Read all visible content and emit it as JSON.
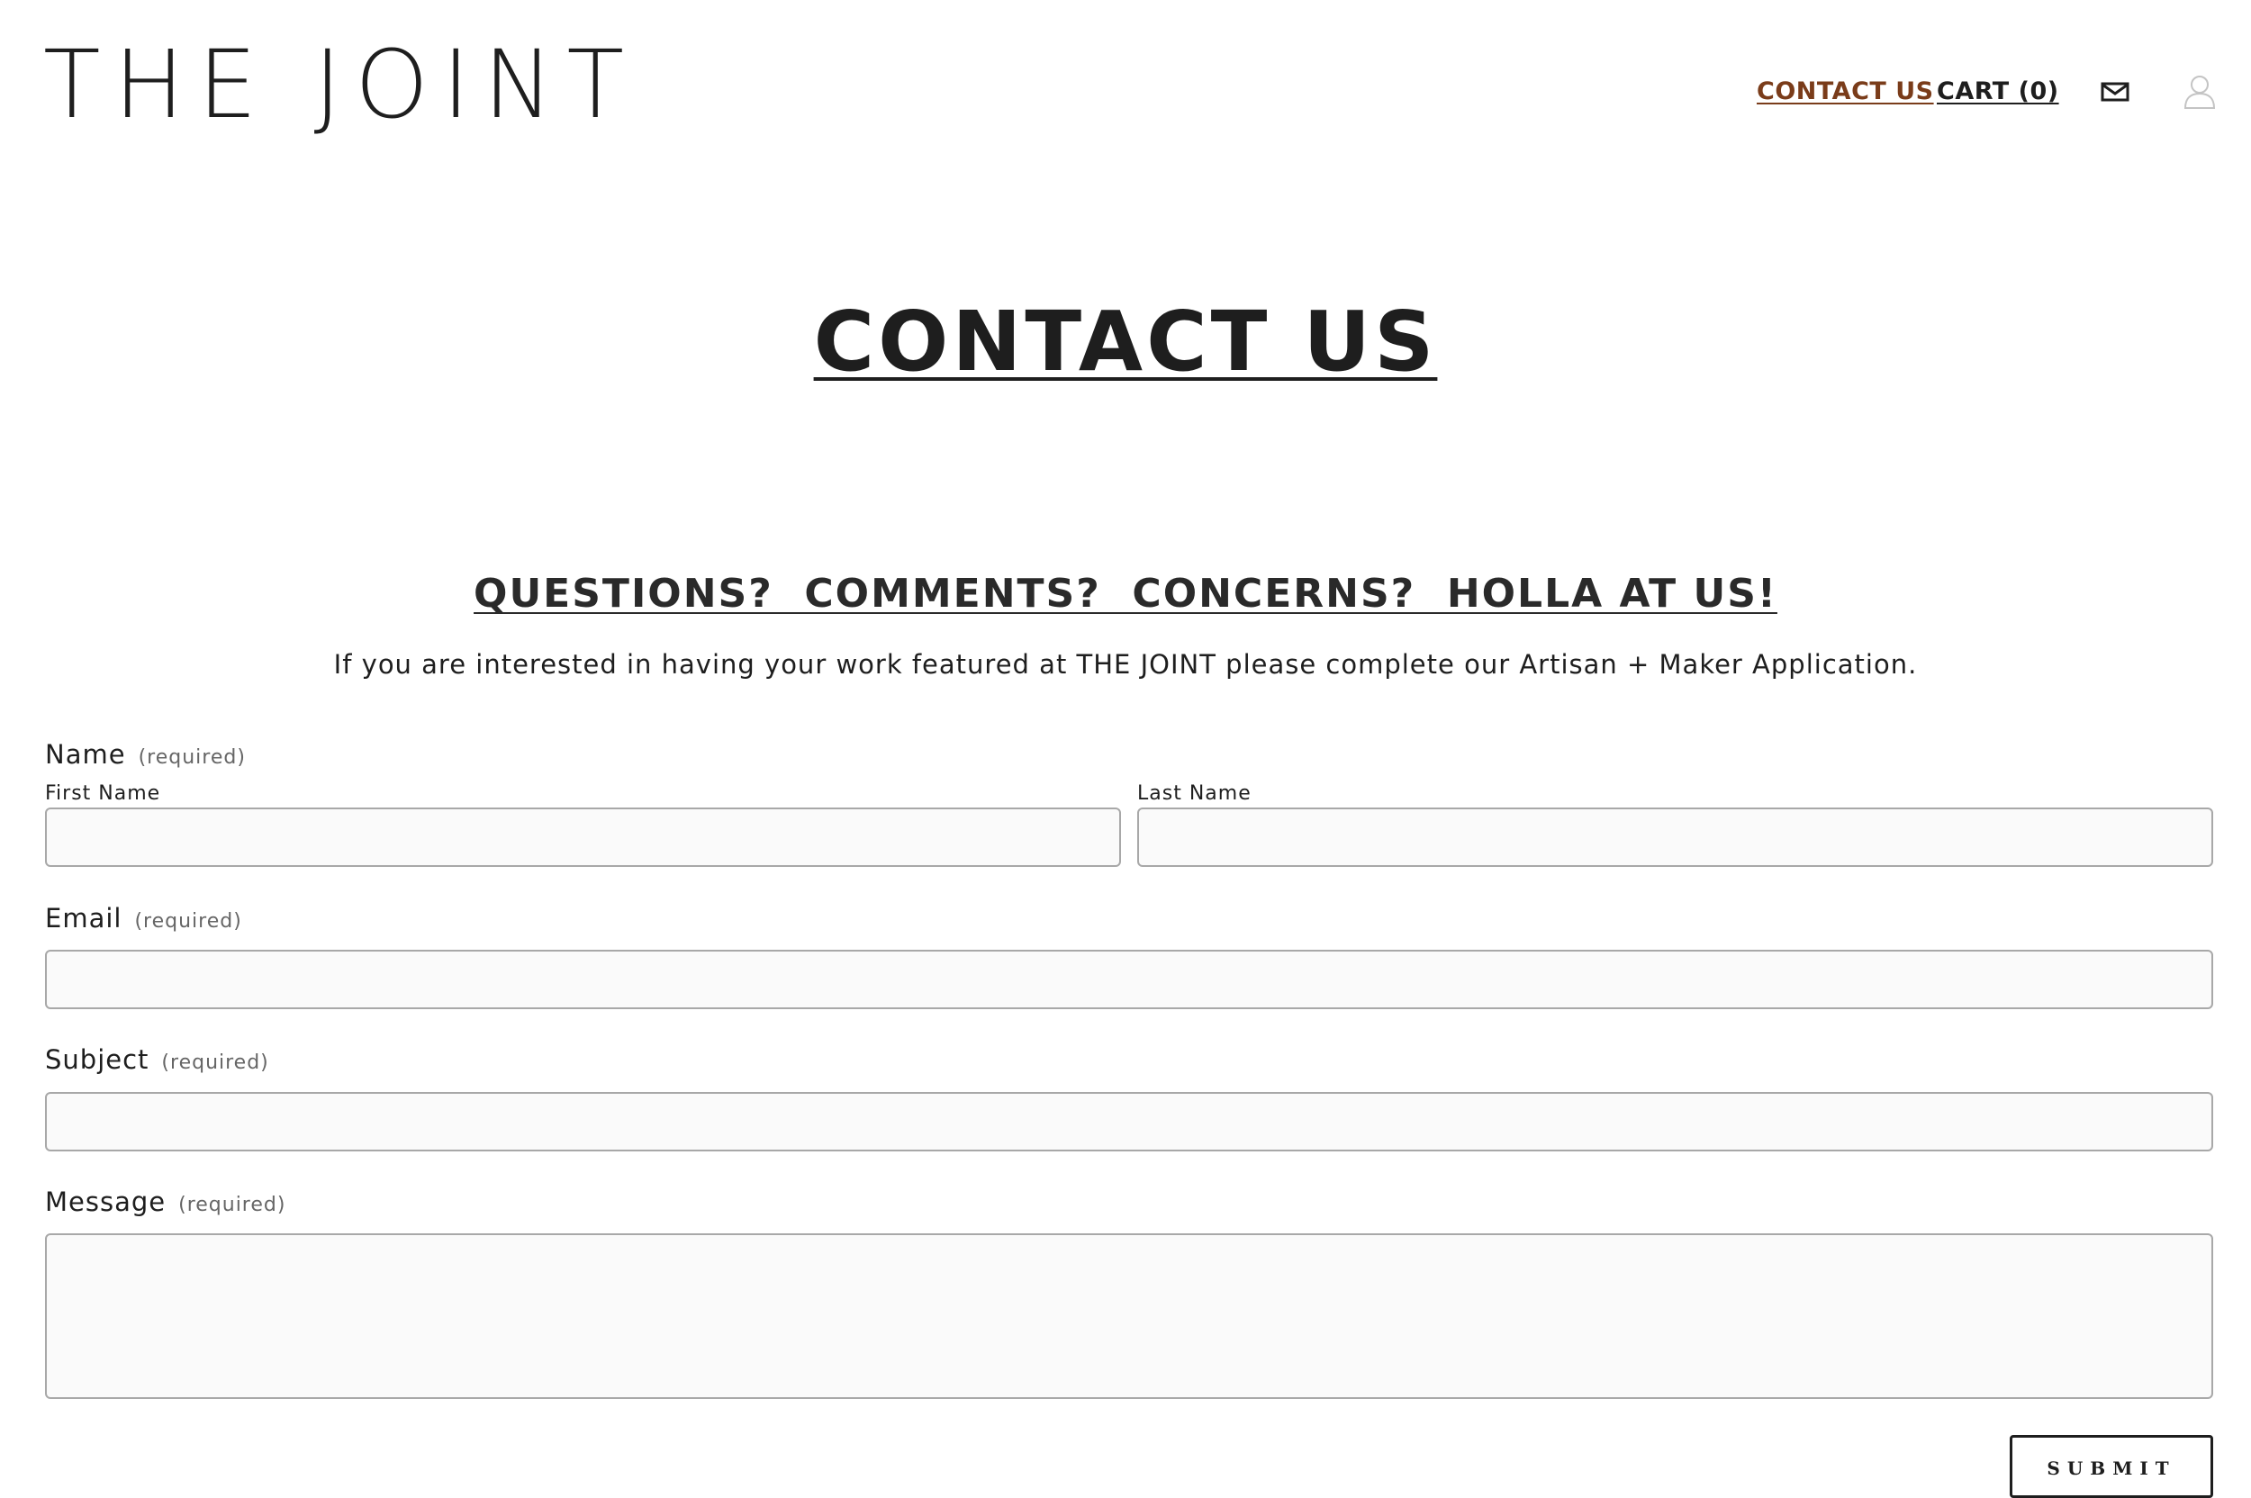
{
  "site": {
    "logo": "THE JOINT"
  },
  "nav": {
    "contact_label": "CONTACT US",
    "cart_label": "CART (0)",
    "icons": [
      "mail-icon",
      "user-icon"
    ],
    "active_color": "#7a3c1a"
  },
  "page": {
    "title": "CONTACT US",
    "subtitle": "QUESTIONS?  COMMENTS?  CONCERNS?  HOLLA AT US!",
    "intro": "If you are interested in having your work featured at THE JOINT please complete our Artisan + Maker Application."
  },
  "form": {
    "required_text": "(required)",
    "name": {
      "label": "Name",
      "first_label": "First Name",
      "first_value": "",
      "last_label": "Last Name",
      "last_value": ""
    },
    "email": {
      "label": "Email",
      "value": ""
    },
    "subject": {
      "label": "Subject",
      "value": ""
    },
    "message": {
      "label": "Message",
      "value": ""
    },
    "submit_label": "SUBMIT"
  }
}
